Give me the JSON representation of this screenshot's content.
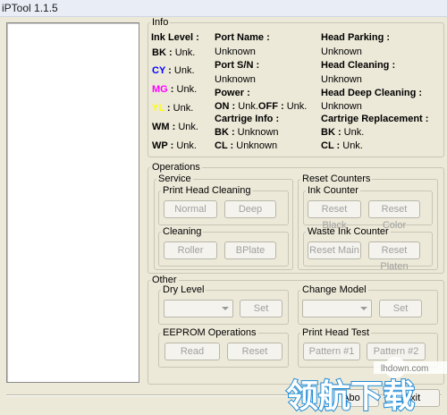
{
  "window": {
    "title": "iPTool 1.1.5"
  },
  "info": {
    "legend": "Info",
    "ink_level": {
      "heading": "Ink Level :",
      "rows": [
        {
          "key": "BK",
          "color": "#000000",
          "value": "Unk."
        },
        {
          "key": "CY",
          "color": "#0000ff",
          "value": "Unk."
        },
        {
          "key": "MG",
          "color": "#ff00ff",
          "value": "Unk."
        },
        {
          "key": "YL",
          "color": "#ffff00",
          "value": "Unk."
        },
        {
          "key": "WM",
          "color": "#000000",
          "value": "Unk."
        },
        {
          "key": "WP",
          "color": "#000000",
          "value": "Unk."
        }
      ]
    },
    "port_name": {
      "heading": "Port Name :",
      "value": "Unknown"
    },
    "port_sn": {
      "heading": "Port S/N :",
      "value": "Unknown"
    },
    "power": {
      "heading": "Power :",
      "on_label": "ON :",
      "on_value": "Unk.",
      "off_label": "OFF :",
      "off_value": "Unk."
    },
    "cartridge_info": {
      "heading": "Cartrige Info :",
      "bk_label": "BK :",
      "bk_value": "Unknown",
      "cl_label": "CL :",
      "cl_value": "Unknown"
    },
    "head_parking": {
      "heading": "Head Parking :",
      "value": "Unknown"
    },
    "head_cleaning": {
      "heading": "Head Cleaning :",
      "value": "Unknown"
    },
    "head_deep_cleaning": {
      "heading": "Head Deep Cleaning :",
      "value": "Unknown"
    },
    "cartridge_replacement": {
      "heading": "Cartrige Replacement :",
      "bk_label": "BK :",
      "bk_value": "Unk.",
      "cl_label": "CL :",
      "cl_value": "Unk."
    }
  },
  "operations": {
    "legend": "Operations",
    "service": {
      "legend": "Service",
      "print_head_cleaning": {
        "legend": "Print Head Cleaning",
        "normal": "Normal",
        "deep": "Deep"
      },
      "cleaning": {
        "legend": "Cleaning",
        "roller": "Roller",
        "bplate": "BPlate"
      }
    },
    "reset_counters": {
      "legend": "Reset Counters",
      "ink_counter": {
        "legend": "Ink Counter",
        "reset_black": "Reset Black",
        "reset_color": "Reset Color"
      },
      "waste_ink_counter": {
        "legend": "Waste Ink Counter",
        "reset_main": "Reset Main",
        "reset_platen": "Reset Platen"
      }
    }
  },
  "other": {
    "legend": "Other",
    "dry_level": {
      "legend": "Dry Level",
      "selected": "",
      "set": "Set"
    },
    "change_model": {
      "legend": "Change Model",
      "selected": "",
      "set": "Set"
    },
    "eeprom": {
      "legend": "EEPROM Operations",
      "read": "Read",
      "reset": "Reset"
    },
    "print_head_test": {
      "legend": "Print Head Test",
      "pattern1": "Pattern #1",
      "pattern2": "Pattern #2"
    }
  },
  "footer": {
    "about": "Abo",
    "exit": "Exit"
  },
  "watermark": {
    "brand": "领航下载",
    "url": "lhdown.com"
  }
}
